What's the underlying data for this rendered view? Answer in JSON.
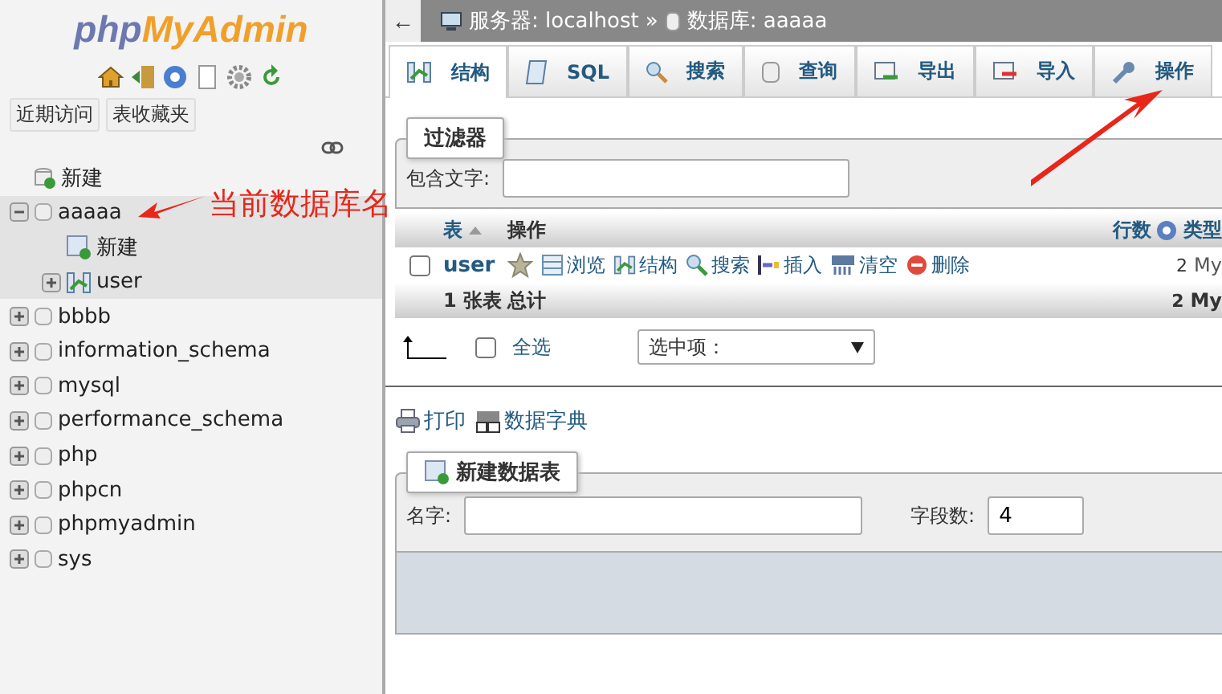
{
  "sidebar": {
    "logo": {
      "part_1": "php",
      "part_2": "MyAdmin"
    },
    "buttons": [
      "近期访问",
      "表收藏夹"
    ],
    "tree": [
      {
        "label": "新建",
        "kind": "new"
      },
      {
        "label": "aaaaa",
        "kind": "db",
        "expanded": true,
        "selected": true,
        "children": [
          {
            "label": "新建",
            "kind": "newtable"
          },
          {
            "label": "user",
            "kind": "table",
            "expanded": false
          }
        ]
      },
      {
        "label": "bbbb",
        "kind": "db",
        "expanded": false,
        "selected": false
      },
      {
        "label": "information_schema",
        "kind": "db",
        "expanded": false,
        "selected": false
      },
      {
        "label": "mysql",
        "kind": "db",
        "expanded": false,
        "selected": false
      },
      {
        "label": "performance_schema",
        "kind": "db",
        "expanded": false,
        "selected": false
      },
      {
        "label": "php",
        "kind": "db",
        "expanded": false,
        "selected": false
      },
      {
        "label": "phpcn",
        "kind": "db",
        "expanded": false,
        "selected": false
      },
      {
        "label": "phpmyadmin",
        "kind": "db",
        "expanded": false,
        "selected": false
      },
      {
        "label": "sys",
        "kind": "db",
        "expanded": false,
        "selected": false
      }
    ]
  },
  "breadcrumb": {
    "back": "←",
    "server": "服务器: localhost",
    "separator": "»",
    "database": "数据库: aaaaa"
  },
  "tabs": [
    {
      "label": "结构",
      "kind": "structure",
      "selected": true
    },
    {
      "label": "SQL",
      "kind": "sql",
      "selected": false
    },
    {
      "label": "搜索",
      "kind": "search",
      "selected": false
    },
    {
      "label": "查询",
      "kind": "query",
      "selected": false
    },
    {
      "label": "导出",
      "kind": "export",
      "selected": false
    },
    {
      "label": "导入",
      "kind": "import",
      "selected": false
    },
    {
      "label": "操作",
      "kind": "wrench",
      "selected": false
    }
  ],
  "filter": {
    "legend": "过滤器",
    "label": "包含文字:"
  },
  "table": {
    "columns": [
      "表",
      "操作",
      "行数",
      "类型"
    ],
    "rows": [
      {
        "name": "user",
        "checked": false,
        "actions": [
          {
            "label": "浏览",
            "kind": "browse"
          },
          {
            "label": "结构",
            "kind": "structure"
          },
          {
            "label": "搜索",
            "kind": "search"
          },
          {
            "label": "插入",
            "kind": "insert"
          },
          {
            "label": "清空",
            "kind": "empty"
          },
          {
            "label": "删除",
            "kind": "drop"
          }
        ],
        "rows": "2",
        "type": "My"
      }
    ],
    "footer": {
      "count": "1 张表",
      "total": "总计",
      "rows": "2",
      "type": "My"
    }
  },
  "bulk": {
    "check_all": "全选",
    "checked": false,
    "select": "选中项："
  },
  "links": [
    "打印",
    "数据字典"
  ],
  "create": {
    "legend": "新建数据表",
    "name_label": "名字:",
    "fields_label": "字段数:",
    "fields_value": "4"
  },
  "annotation": {
    "text": "当前数据库名"
  }
}
